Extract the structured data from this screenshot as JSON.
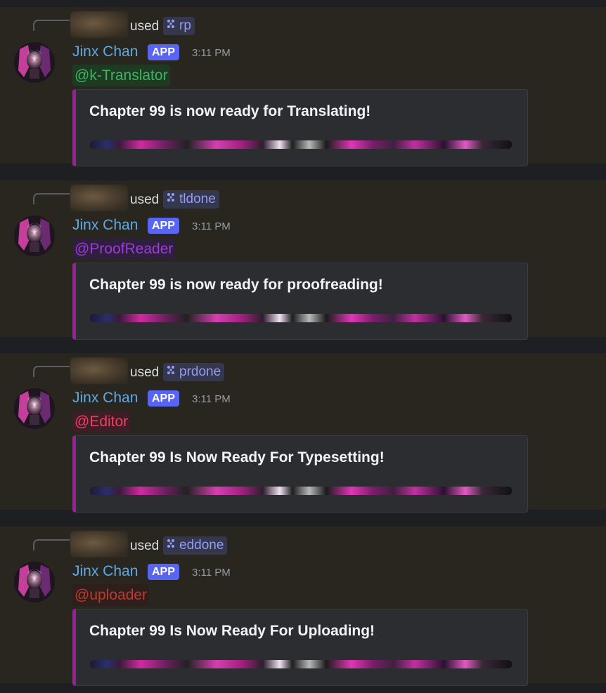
{
  "colors": {
    "background": "#1e1f22",
    "highlight_background": "#29261f",
    "embed_background": "#2b2d31",
    "embed_accent": "#9c1e98",
    "author": "#5ea9e6",
    "app_badge": "#5865f2",
    "command": "#949cf7",
    "timestamp": "#949ba4"
  },
  "messages": [
    {
      "used_text": "used",
      "command": {
        "icon": "slash-command-icon",
        "name": "rp"
      },
      "author": "Jinx Chan",
      "badge": "APP",
      "time": "3:11 PM",
      "mention": {
        "text": "@k-Translator",
        "color": "#3bb660",
        "bg": "#1f3a23"
      },
      "embed": {
        "title": "Chapter 99 is now ready for Translating!"
      }
    },
    {
      "used_text": "used",
      "command": {
        "icon": "slash-command-icon",
        "name": "tldone"
      },
      "author": "Jinx Chan",
      "badge": "APP",
      "time": "3:11 PM",
      "mention": {
        "text": "@ProofReader",
        "color": "#9b3cd6",
        "bg": "#2e1f3c"
      },
      "embed": {
        "title": "Chapter 99 is now ready for proofreading!"
      }
    },
    {
      "used_text": "used",
      "command": {
        "icon": "slash-command-icon",
        "name": "prdone"
      },
      "author": "Jinx Chan",
      "badge": "APP",
      "time": "3:11 PM",
      "mention": {
        "text": "@Editor",
        "color": "#ef3f63",
        "bg": "#3d1e26"
      },
      "embed": {
        "title": "Chapter 99 Is Now Ready For Typesetting!"
      }
    },
    {
      "used_text": "used",
      "command": {
        "icon": "slash-command-icon",
        "name": "eddone"
      },
      "author": "Jinx Chan",
      "badge": "APP",
      "time": "3:11 PM",
      "mention": {
        "text": "@uploader",
        "color": "#c0392b",
        "bg": "#2e1f1c"
      },
      "embed": {
        "title": "Chapter 99 Is Now Ready For Uploading!"
      }
    }
  ]
}
